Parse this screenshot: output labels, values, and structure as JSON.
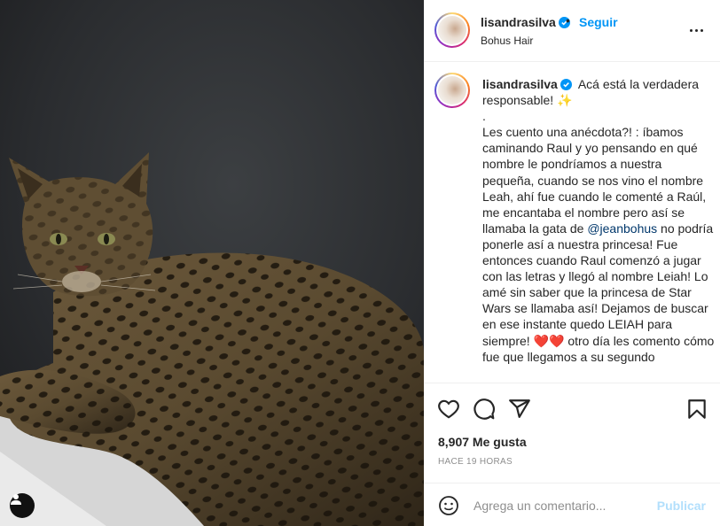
{
  "post": {
    "author": "lisandrasilva",
    "follow_label": "Seguir",
    "location": "Bohus Hair",
    "separator": "•"
  },
  "caption": {
    "author": "lisandrasilva",
    "intro": "Acá está la verdadera responsable! ✨",
    "line_dot": ".",
    "body_1": "Les cuento una anécdota?! : íbamos caminando Raul y yo pensando en qué nombre le pondríamos a nuestra pequeña, cuando se nos vino el nombre Leah, ahí fue cuando le comenté a Raúl, me encantaba el nombre pero así se llamaba la gata de",
    "mention": "@jeanbohus",
    "body_2": "no podría ponerle así a nuestra princesa! Fue entonces cuando Raul comenzó a jugar con las letras y llegó al nombre Leiah! Lo amé sin saber que la princesa de Star Wars se llamaba así! Dejamos de buscar en ese instante quedo LEIAH para siempre! ❤️❤️ otro día les comento cómo fue que llegamos a su segundo"
  },
  "stats": {
    "likes": "8,907 Me gusta",
    "time_ago": "HACE 19 HORAS"
  },
  "comment": {
    "placeholder": "Agrega un comentario...",
    "publish_label": "Publicar"
  },
  "colors": {
    "accent": "#0095f6",
    "publish_disabled": "#b2dffc",
    "mention": "#00376b",
    "muted": "#8e8e8e"
  },
  "icons": [
    "user-tag-icon",
    "verified-badge-icon",
    "more-options-icon",
    "heart-icon",
    "comment-icon",
    "share-icon",
    "bookmark-icon",
    "emoji-icon"
  ]
}
